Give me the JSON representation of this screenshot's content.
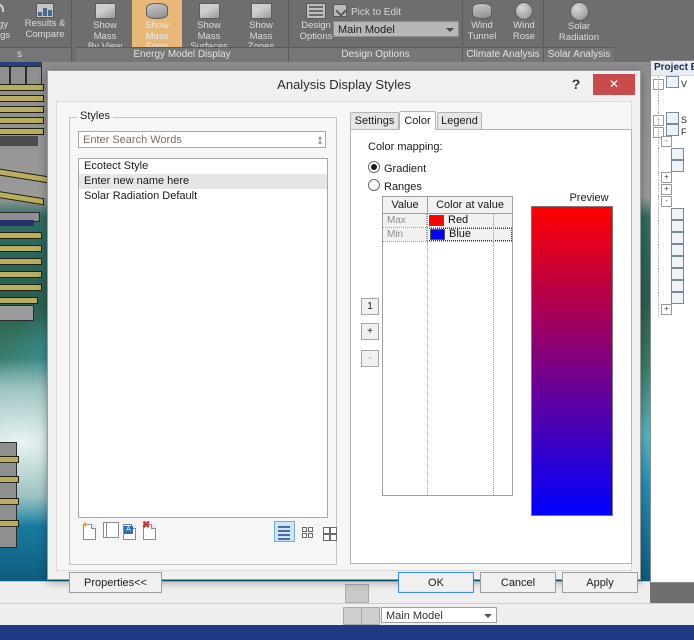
{
  "ribbon": {
    "panels": [
      {
        "title": "s",
        "buttons": [
          {
            "label": "Energy\nSettings",
            "icon": "fork-icon"
          },
          {
            "label": "Results &\nCompare",
            "icon": "chart-icon"
          }
        ]
      },
      {
        "title": "Energy Model Display",
        "buttons": [
          {
            "label": "Show Mass\nBy View",
            "icon": "cube-icon",
            "active": false
          },
          {
            "label": "Show Mass\nForm",
            "icon": "cyl-icon",
            "active": true
          },
          {
            "label": "Show Mass\nSurfaces",
            "icon": "cube-icon",
            "active": false
          },
          {
            "label": "Show Mass\nZones",
            "icon": "cube-icon",
            "active": false
          }
        ]
      },
      {
        "title": "Design Options",
        "buttons": [
          {
            "label": "Design\nOptions",
            "icon": "sheet-icon"
          }
        ],
        "pick_to_edit": "Pick to Edit",
        "combo_value": "Main Model"
      },
      {
        "title": "Climate Analysis",
        "buttons": [
          {
            "label": "Wind\nTunnel",
            "icon": "cyl-icon"
          },
          {
            "label": "Wind\nRose",
            "icon": "sphere-icon"
          }
        ]
      },
      {
        "title": "Solar Analysis",
        "buttons": [
          {
            "label": "Solar\nRadiation",
            "icon": "sphere-icon"
          }
        ]
      }
    ]
  },
  "project_browser": {
    "title": "Project B",
    "rows": [
      {
        "indent": 0,
        "expander": "-",
        "icon": "views-icon",
        "label": "V"
      },
      {
        "indent": 1,
        "expander": "",
        "icon": "",
        "label": ""
      },
      {
        "indent": 1,
        "expander": "",
        "icon": "",
        "label": ""
      },
      {
        "indent": 0,
        "expander": "-",
        "icon": "schedules-icon",
        "label": "S"
      },
      {
        "indent": 0,
        "expander": "-",
        "icon": "families-icon",
        "label": "F"
      },
      {
        "indent": 1,
        "expander": "-",
        "icon": "",
        "label": ""
      },
      {
        "indent": 2,
        "expander": "",
        "icon": "item-icon",
        "label": ""
      },
      {
        "indent": 2,
        "expander": "",
        "icon": "item-icon",
        "label": ""
      },
      {
        "indent": 1,
        "expander": "+",
        "icon": "",
        "label": ""
      },
      {
        "indent": 1,
        "expander": "+",
        "icon": "",
        "label": ""
      },
      {
        "indent": 1,
        "expander": "-",
        "icon": "",
        "label": ""
      },
      {
        "indent": 2,
        "expander": "",
        "icon": "item-icon",
        "label": ""
      },
      {
        "indent": 2,
        "expander": "",
        "icon": "item-icon",
        "label": ""
      },
      {
        "indent": 2,
        "expander": "",
        "icon": "item-icon",
        "label": ""
      },
      {
        "indent": 2,
        "expander": "",
        "icon": "item-icon",
        "label": ""
      },
      {
        "indent": 2,
        "expander": "",
        "icon": "item-icon",
        "label": ""
      },
      {
        "indent": 2,
        "expander": "",
        "icon": "item-icon",
        "label": ""
      },
      {
        "indent": 2,
        "expander": "",
        "icon": "item-icon",
        "label": ""
      },
      {
        "indent": 2,
        "expander": "",
        "icon": "item-icon",
        "label": ""
      },
      {
        "indent": 1,
        "expander": "+",
        "icon": "",
        "label": ""
      }
    ]
  },
  "dialog": {
    "title": "Analysis Display Styles",
    "help_label": "?",
    "close_label": "✕",
    "styles": {
      "group_label": "Styles",
      "search_value": "Enter Search Words",
      "items": [
        {
          "label": "Ecotect Style",
          "selected": false
        },
        {
          "label": "Enter new name here",
          "selected": true
        },
        {
          "label": "Solar Radiation Default",
          "selected": false
        }
      ],
      "tools": [
        {
          "name": "new-style-icon",
          "title": "New"
        },
        {
          "name": "duplicate-style-icon",
          "title": "Duplicate"
        },
        {
          "name": "rename-style-icon",
          "title": "Rename"
        },
        {
          "name": "delete-style-icon",
          "title": "Delete"
        }
      ],
      "view_modes": [
        {
          "name": "list-view-icon",
          "active": true
        },
        {
          "name": "small-icons-view-icon",
          "active": false
        },
        {
          "name": "large-icons-view-icon",
          "active": false
        }
      ]
    },
    "tabs": [
      {
        "label": "Settings",
        "active": false
      },
      {
        "label": "Color",
        "active": true
      },
      {
        "label": "Legend",
        "active": false
      }
    ],
    "color_tab": {
      "color_mapping_label": "Color mapping:",
      "options": [
        {
          "label": "Gradient",
          "selected": true
        },
        {
          "label": "Ranges",
          "selected": false
        }
      ],
      "table": {
        "headers": [
          "Value",
          "Color at value"
        ],
        "rows": [
          {
            "value": "Max",
            "color_name": "Red",
            "color_hex": "#ff0000",
            "selected": false
          },
          {
            "value": "Min",
            "color_name": "Blue",
            "color_hex": "#0000ff",
            "selected": true
          }
        ]
      },
      "stepper": {
        "count_value": "1",
        "add_label": "+",
        "remove_label": "-"
      },
      "preview": {
        "label": "Preview",
        "top_color": "#ff0000",
        "bottom_color": "#0000ff"
      }
    },
    "footer": {
      "properties_label": "Properties<<",
      "ok_label": "OK",
      "cancel_label": "Cancel",
      "apply_label": "Apply"
    }
  },
  "status_bar": {
    "combo_value": "Main Model"
  }
}
